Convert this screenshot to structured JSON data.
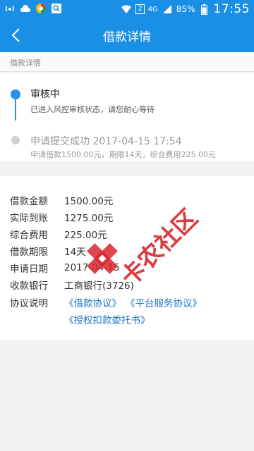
{
  "status_bar": {
    "battery": "85%",
    "time": "17:55",
    "network": "4G",
    "sim_badge": "2"
  },
  "header": {
    "title": "借款详情"
  },
  "section": {
    "title": "借款详情"
  },
  "timeline": [
    {
      "title": "审核中",
      "desc": "已进入风控审核状态，请您耐心等待"
    },
    {
      "title": "申请提交成功 2017-04-15 17:54",
      "desc": "申请借款1500.00元，期限14天，综合费用225.00元"
    }
  ],
  "details": {
    "amount_label": "借款金额",
    "amount_value": "1500.00元",
    "received_label": "实际到账",
    "received_value": "1275.00元",
    "fee_label": "综合费用",
    "fee_value": "225.00元",
    "term_label": "借款期限",
    "term_value": "14天",
    "date_label": "申请日期",
    "date_value": "2017-04-15",
    "bank_label": "收款银行",
    "bank_value": "工商银行(3726)",
    "agreement_label": "协议说明",
    "agreements": [
      "《借款协议》",
      "《平台服务协议》",
      "《授权扣款委托书》"
    ]
  },
  "watermark": {
    "text": "卡农社区"
  },
  "colors": {
    "brand": "#1a8fe6",
    "link": "#1a73c7",
    "timeline_active": "#2a8fe8",
    "watermark": "#d9262e"
  }
}
